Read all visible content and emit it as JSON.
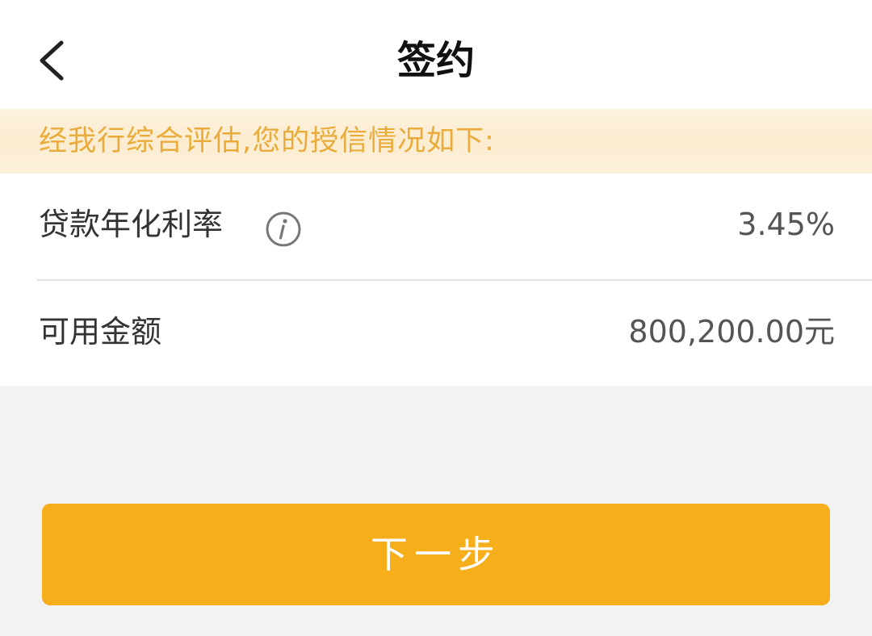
{
  "header": {
    "title": "签约",
    "back_icon": "chevron-left-icon"
  },
  "notice": {
    "text": "经我行综合评估,您的授信情况如下:"
  },
  "credit": {
    "rate": {
      "label": "贷款年化利率",
      "value": "3.45%",
      "info_icon": "info-icon"
    },
    "amount": {
      "label": "可用金额",
      "value": "800,200.00元"
    }
  },
  "actions": {
    "next_label": "下一步"
  },
  "colors": {
    "accent": "#f7ae1b",
    "notice_text": "#e9ac3a",
    "notice_bg": "#fcecd0",
    "page_bg": "#f2f2f2"
  }
}
